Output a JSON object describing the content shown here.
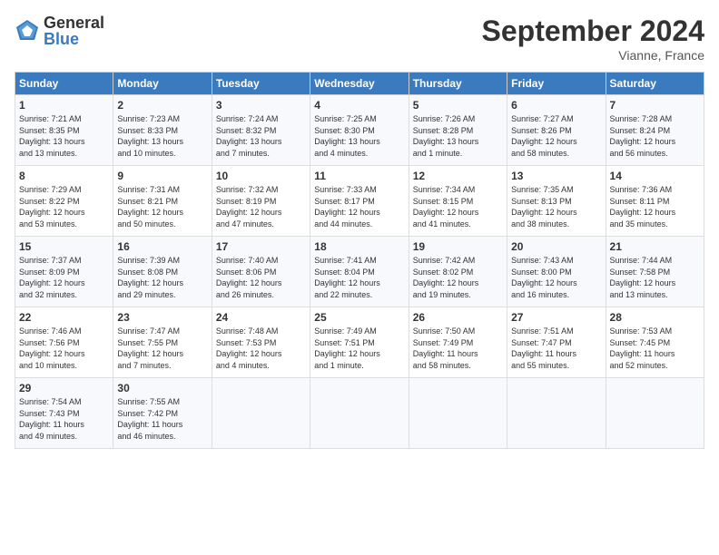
{
  "logo": {
    "general": "General",
    "blue": "Blue"
  },
  "header": {
    "title": "September 2024",
    "subtitle": "Vianne, France"
  },
  "days_of_week": [
    "Sunday",
    "Monday",
    "Tuesday",
    "Wednesday",
    "Thursday",
    "Friday",
    "Saturday"
  ],
  "weeks": [
    [
      {
        "day": "1",
        "info": "Sunrise: 7:21 AM\nSunset: 8:35 PM\nDaylight: 13 hours\nand 13 minutes."
      },
      {
        "day": "2",
        "info": "Sunrise: 7:23 AM\nSunset: 8:33 PM\nDaylight: 13 hours\nand 10 minutes."
      },
      {
        "day": "3",
        "info": "Sunrise: 7:24 AM\nSunset: 8:32 PM\nDaylight: 13 hours\nand 7 minutes."
      },
      {
        "day": "4",
        "info": "Sunrise: 7:25 AM\nSunset: 8:30 PM\nDaylight: 13 hours\nand 4 minutes."
      },
      {
        "day": "5",
        "info": "Sunrise: 7:26 AM\nSunset: 8:28 PM\nDaylight: 13 hours\nand 1 minute."
      },
      {
        "day": "6",
        "info": "Sunrise: 7:27 AM\nSunset: 8:26 PM\nDaylight: 12 hours\nand 58 minutes."
      },
      {
        "day": "7",
        "info": "Sunrise: 7:28 AM\nSunset: 8:24 PM\nDaylight: 12 hours\nand 56 minutes."
      }
    ],
    [
      {
        "day": "8",
        "info": "Sunrise: 7:29 AM\nSunset: 8:22 PM\nDaylight: 12 hours\nand 53 minutes."
      },
      {
        "day": "9",
        "info": "Sunrise: 7:31 AM\nSunset: 8:21 PM\nDaylight: 12 hours\nand 50 minutes."
      },
      {
        "day": "10",
        "info": "Sunrise: 7:32 AM\nSunset: 8:19 PM\nDaylight: 12 hours\nand 47 minutes."
      },
      {
        "day": "11",
        "info": "Sunrise: 7:33 AM\nSunset: 8:17 PM\nDaylight: 12 hours\nand 44 minutes."
      },
      {
        "day": "12",
        "info": "Sunrise: 7:34 AM\nSunset: 8:15 PM\nDaylight: 12 hours\nand 41 minutes."
      },
      {
        "day": "13",
        "info": "Sunrise: 7:35 AM\nSunset: 8:13 PM\nDaylight: 12 hours\nand 38 minutes."
      },
      {
        "day": "14",
        "info": "Sunrise: 7:36 AM\nSunset: 8:11 PM\nDaylight: 12 hours\nand 35 minutes."
      }
    ],
    [
      {
        "day": "15",
        "info": "Sunrise: 7:37 AM\nSunset: 8:09 PM\nDaylight: 12 hours\nand 32 minutes."
      },
      {
        "day": "16",
        "info": "Sunrise: 7:39 AM\nSunset: 8:08 PM\nDaylight: 12 hours\nand 29 minutes."
      },
      {
        "day": "17",
        "info": "Sunrise: 7:40 AM\nSunset: 8:06 PM\nDaylight: 12 hours\nand 26 minutes."
      },
      {
        "day": "18",
        "info": "Sunrise: 7:41 AM\nSunset: 8:04 PM\nDaylight: 12 hours\nand 22 minutes."
      },
      {
        "day": "19",
        "info": "Sunrise: 7:42 AM\nSunset: 8:02 PM\nDaylight: 12 hours\nand 19 minutes."
      },
      {
        "day": "20",
        "info": "Sunrise: 7:43 AM\nSunset: 8:00 PM\nDaylight: 12 hours\nand 16 minutes."
      },
      {
        "day": "21",
        "info": "Sunrise: 7:44 AM\nSunset: 7:58 PM\nDaylight: 12 hours\nand 13 minutes."
      }
    ],
    [
      {
        "day": "22",
        "info": "Sunrise: 7:46 AM\nSunset: 7:56 PM\nDaylight: 12 hours\nand 10 minutes."
      },
      {
        "day": "23",
        "info": "Sunrise: 7:47 AM\nSunset: 7:55 PM\nDaylight: 12 hours\nand 7 minutes."
      },
      {
        "day": "24",
        "info": "Sunrise: 7:48 AM\nSunset: 7:53 PM\nDaylight: 12 hours\nand 4 minutes."
      },
      {
        "day": "25",
        "info": "Sunrise: 7:49 AM\nSunset: 7:51 PM\nDaylight: 12 hours\nand 1 minute."
      },
      {
        "day": "26",
        "info": "Sunrise: 7:50 AM\nSunset: 7:49 PM\nDaylight: 11 hours\nand 58 minutes."
      },
      {
        "day": "27",
        "info": "Sunrise: 7:51 AM\nSunset: 7:47 PM\nDaylight: 11 hours\nand 55 minutes."
      },
      {
        "day": "28",
        "info": "Sunrise: 7:53 AM\nSunset: 7:45 PM\nDaylight: 11 hours\nand 52 minutes."
      }
    ],
    [
      {
        "day": "29",
        "info": "Sunrise: 7:54 AM\nSunset: 7:43 PM\nDaylight: 11 hours\nand 49 minutes."
      },
      {
        "day": "30",
        "info": "Sunrise: 7:55 AM\nSunset: 7:42 PM\nDaylight: 11 hours\nand 46 minutes."
      },
      {
        "day": "",
        "info": ""
      },
      {
        "day": "",
        "info": ""
      },
      {
        "day": "",
        "info": ""
      },
      {
        "day": "",
        "info": ""
      },
      {
        "day": "",
        "info": ""
      }
    ]
  ]
}
